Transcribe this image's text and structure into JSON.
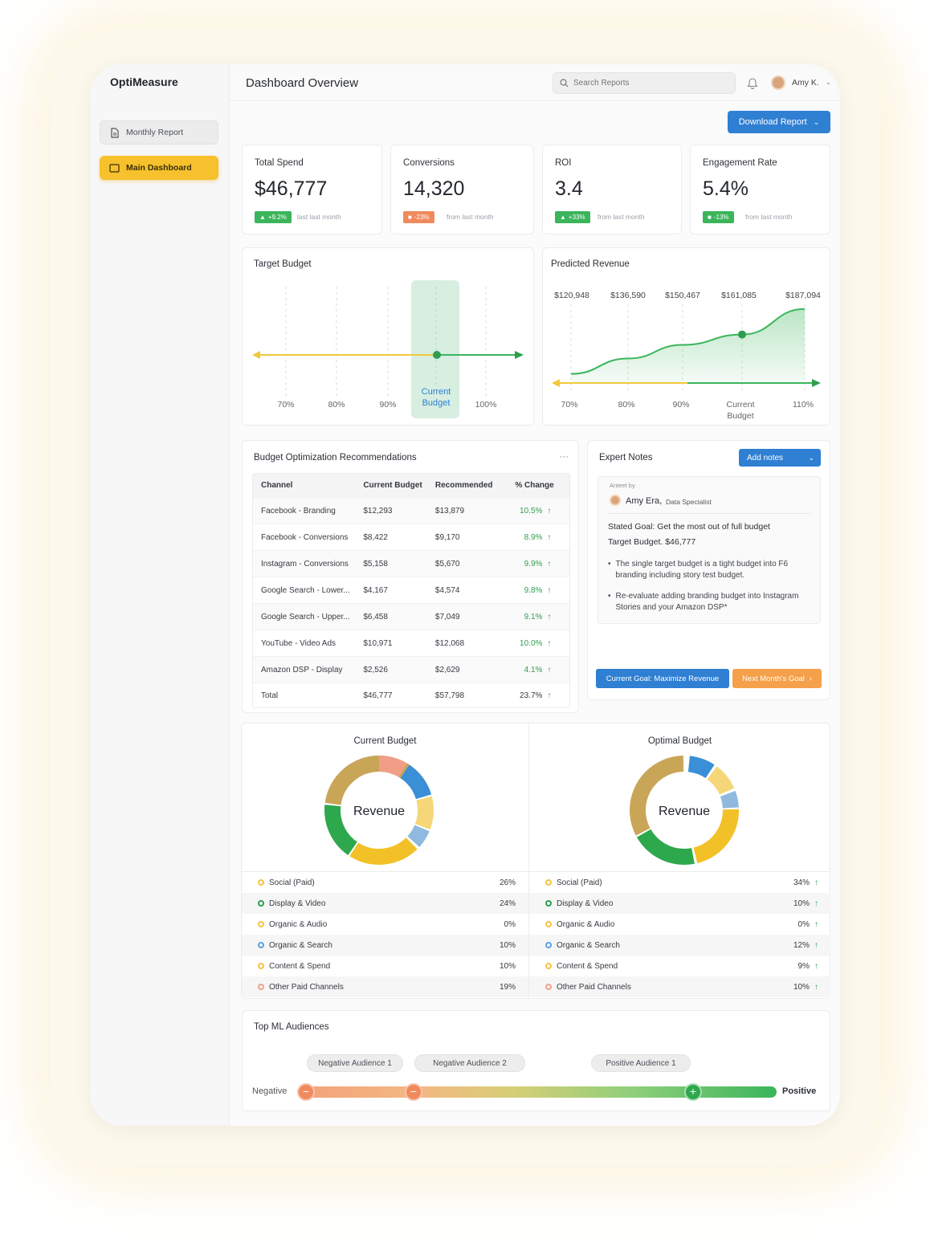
{
  "app": {
    "brand": "OptiMeasure",
    "page_title": "Dashboard Overview"
  },
  "sidebar": {
    "items": [
      {
        "label": "Monthly Report",
        "icon": "document-icon"
      },
      {
        "label": "Main Dashboard",
        "icon": "dashboard-icon",
        "active": true
      }
    ]
  },
  "search": {
    "placeholder": "Search Reports"
  },
  "user": {
    "name": "Amy K."
  },
  "toolbar": {
    "download_label": "Download Report"
  },
  "kpis": [
    {
      "title": "Total Spend",
      "value": "$46,777",
      "badge": "+9.2%",
      "badge_color": "#3bb55b",
      "note": "last last month"
    },
    {
      "title": "Conversions",
      "value": "14,320",
      "badge": "-23%",
      "badge_color": "#f08a5d",
      "note": "from last month"
    },
    {
      "title": "ROI",
      "value": "3.4",
      "badge": "+33%",
      "badge_color": "#3bb55b",
      "note": "from last month"
    },
    {
      "title": "Engagement Rate",
      "value": "5.4%",
      "badge": "-13%",
      "badge_color": "#3bb55b",
      "note": "from last month"
    }
  ],
  "target_budget": {
    "title": "Target Budget",
    "ticks": [
      "70%",
      "80%",
      "90%",
      "Current",
      "Budget",
      "100%"
    ],
    "current_label": [
      "Current",
      "Budget"
    ]
  },
  "chart_data": {
    "type": "area",
    "title": "Predicted Revenue",
    "top_labels": [
      "$120,948",
      "$136,590",
      "$150,467",
      "$161,085",
      "$187,094"
    ],
    "x": [
      "70%",
      "80%",
      "90%",
      "Current Budget",
      "110%"
    ],
    "values": [
      120948,
      136590,
      150467,
      161085,
      187094
    ],
    "tick_labels": [
      "70%",
      "80%",
      "90%",
      "Current",
      "Budget",
      "110%"
    ],
    "highlight": "Current Budget"
  },
  "recommendations": {
    "title": "Budget Optimization Recommendations",
    "more": "···",
    "columns": [
      "Channel",
      "Current Budget",
      "Recommended",
      "% Change"
    ],
    "rows": [
      [
        "Facebook - Branding",
        "$12,293",
        "$13,879",
        "10.5%"
      ],
      [
        "Facebook - Conversions",
        "$8,422",
        "$9,170",
        "8.9%"
      ],
      [
        "Instagram - Conversions",
        "$5,158",
        "$5,670",
        "9.9%"
      ],
      [
        "Google Search - Lower...",
        "$4,167",
        "$4,574",
        "9.8%"
      ],
      [
        "Google Search - Upper...",
        "$6,458",
        "$7,049",
        "9.1%"
      ],
      [
        "YouTube - Video Ads",
        "$10,971",
        "$12,068",
        "10.0%"
      ],
      [
        "Amazon DSP - Display",
        "$2,526",
        "$2,629",
        "4.1%"
      ]
    ],
    "total": [
      "Total",
      "$46,777",
      "$57,798",
      "23.7%"
    ]
  },
  "notes": {
    "title": "Expert Notes",
    "add_label": "Add notes",
    "author_caption": "Anteet by",
    "author_name": "Amy Era,",
    "author_role": "Data Specialist",
    "goal_line": "Stated Goal: Get the most out of full budget",
    "target_line": "Target Budget. $46,777",
    "bullets": [
      "The single target budget is a tight budget into F6 branding including story test budget.",
      "Re-evaluate adding branding budget into Instagram Stories and your Amazon DSP*"
    ],
    "current_goal": "Current Goal: Maximize Revenue",
    "next_goal": "Next Month's Goal"
  },
  "donuts": {
    "center_label": "Revenue",
    "current": {
      "title": "Current Budget",
      "rows": [
        {
          "label": "Social (Paid)",
          "value": "26%",
          "color": "#f5c242"
        },
        {
          "label": "Display & Video",
          "value": "24%",
          "color": "#2e9d4e"
        },
        {
          "label": "Organic & Audio",
          "value": "0%",
          "color": "#f5c242"
        },
        {
          "label": "Organic & Search",
          "value": "10%",
          "color": "#5ba3e0"
        },
        {
          "label": "Content & Spend",
          "value": "10%",
          "color": "#f5c242"
        },
        {
          "label": "Other Paid Channels",
          "value": "19%",
          "color": "#f0a08a"
        }
      ]
    },
    "optimal": {
      "title": "Optimal Budget",
      "rows": [
        {
          "label": "Social (Paid)",
          "value": "34%",
          "color": "#f5c242"
        },
        {
          "label": "Display & Video",
          "value": "10%",
          "color": "#2e9d4e"
        },
        {
          "label": "Organic & Audio",
          "value": "0%",
          "color": "#f5c242"
        },
        {
          "label": "Organic & Search",
          "value": "12%",
          "color": "#5ba3e0"
        },
        {
          "label": "Content & Spend",
          "value": "9%",
          "color": "#f5c242"
        },
        {
          "label": "Other Paid Channels",
          "value": "10%",
          "color": "#f0a08a"
        }
      ]
    }
  },
  "audiences": {
    "title": "Top ML Audiences",
    "pills": [
      "Negative Audience 1",
      "Negative Audience 2",
      "Positive Audience 1"
    ],
    "left_label": "Negative",
    "right_label": "Positive"
  }
}
